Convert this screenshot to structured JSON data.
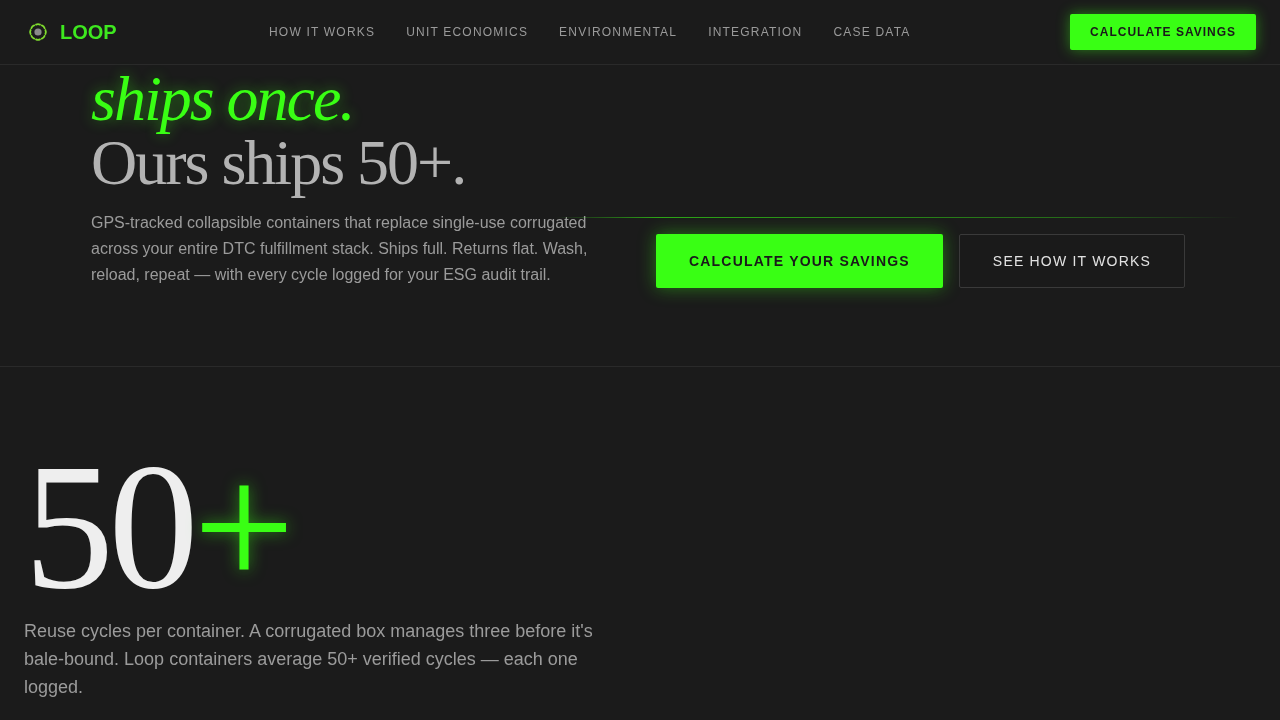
{
  "nav": {
    "brand": "LOOP",
    "links": [
      {
        "label": "HOW IT WORKS"
      },
      {
        "label": "UNIT ECONOMICS"
      },
      {
        "label": "ENVIRONMENTAL"
      },
      {
        "label": "INTEGRATION"
      },
      {
        "label": "CASE DATA"
      }
    ],
    "cta": "CALCULATE SAVINGS"
  },
  "hero": {
    "headline": [
      {
        "text": "ships once.",
        "kind": "accent"
      },
      {
        "text": "Ours ships 50+.",
        "kind": "plain"
      }
    ],
    "description": "GPS-tracked collapsible containers that replace single-use corrugated across your entire DTC fulfillment stack. Ships full. Returns flat. Wash, reload, repeat — with every cycle logged for your ESG audit trail.",
    "buttons": [
      {
        "label": "CALCULATE YOUR SAVINGS",
        "kind": "primary"
      },
      {
        "label": "SEE HOW IT WORKS",
        "kind": "outline"
      }
    ]
  },
  "stat": {
    "value": "50",
    "suffix": "+",
    "description": "Reuse cycles per container. A corrugated box manages three before it's bale-bound. Loop containers average 50+ verified cycles — each one logged."
  }
}
